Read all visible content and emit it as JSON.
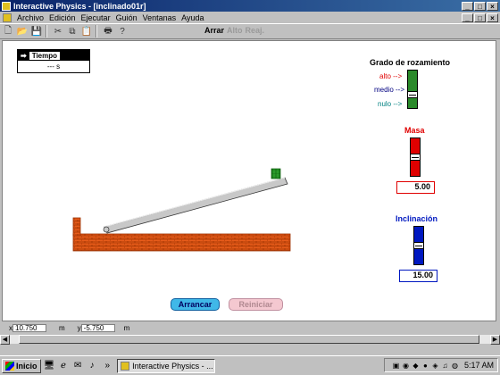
{
  "window": {
    "title": "Interactive Physics - [inclinado01r]",
    "min_icon": "_",
    "max_icon": "□",
    "close_icon": "×"
  },
  "menu": {
    "items": [
      "Archivo",
      "Edición",
      "Ejecutar",
      "Guión",
      "Ventanas",
      "Ayuda"
    ],
    "doc_min_icon": "_",
    "doc_max_icon": "□",
    "doc_close_icon": "×"
  },
  "toolbar": {
    "run_label": "Arrar",
    "stop_label": "Alto",
    "reset_label": "Reaj."
  },
  "time_meter": {
    "label": "Tiempo",
    "value": "--- s"
  },
  "friction": {
    "title": "Grado de rozamiento",
    "levels": [
      {
        "label": "alto -->",
        "color": "#e00000"
      },
      {
        "label": "medio -->",
        "color": "#000080"
      },
      {
        "label": "nulo -->",
        "color": "#008080"
      }
    ],
    "color": "#2a8a2a",
    "level": 0.33
  },
  "mass": {
    "title": "Masa",
    "value": "5.00",
    "color": "#e00000",
    "level": 0.5
  },
  "inclination": {
    "title": "Inclinación",
    "value": "15.00",
    "color": "#0018c0",
    "level": 0.5
  },
  "buttons": {
    "start": "Arrancar",
    "restart": "Reiniciar"
  },
  "status": {
    "x_label": "x",
    "x_value": "10.750",
    "x_unit": "m",
    "y_label": "y",
    "y_value": "-5.750",
    "y_unit": "m"
  },
  "taskbar": {
    "start_label": "Inicio",
    "chevron": "»",
    "task_label": "Interactive Physics - ...",
    "clock": "5:17 AM"
  },
  "colors": {
    "brick": "#e85c1a",
    "brick_mortar": "#9a3000",
    "ramp": "#c8c8c8",
    "block": "#2a9a2a",
    "start_button": "#40b8e8",
    "restart_button": "#f4c8d0"
  }
}
